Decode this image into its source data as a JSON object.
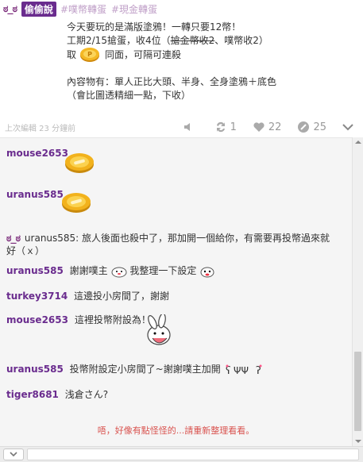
{
  "post": {
    "author_face": "ಠ_ಠ",
    "badge": "偷偷說",
    "tags": [
      "#噗幣轉蛋",
      "#現金轉蛋"
    ],
    "lines": {
      "l1": "今天要玩的是滿版塗鴉！一轉只要12幣！",
      "l2_a": "工期2/15搶蛋，收4位（",
      "l2_strike": "搶金幣收2",
      "l2_b": "、噗幣收2）",
      "l3_a": "取",
      "l3_b": "同面，可隔可連殺",
      "l5": "內容物有：單人正比大頭、半身、全身塗鴉＋底色",
      "l6": "（會比圖透精細一點，下收）"
    },
    "edited": "上次編輯 23 分鐘前",
    "actions": {
      "mute_icon": "mute-icon",
      "replurk_count": "1",
      "like_count": "22",
      "response_count": "25"
    }
  },
  "comments": [
    {
      "user": "mouse2653",
      "text": "",
      "sticker": "coin"
    },
    {
      "user": "uranus585",
      "text": "",
      "sticker": "coin"
    },
    {
      "user_face": "ಠ_ಠ",
      "text_a": "uranus585: 旅人後面也殺中了，那加開一個給你，有需要再投幣過來就",
      "text_b": "好（ｘ）"
    },
    {
      "user": "uranus585",
      "text_a": "謝謝噗主",
      "text_b": "我整理一下設定"
    },
    {
      "user": "turkey3714",
      "text": "這邊投小房間了，謝謝"
    },
    {
      "user": "mouse2653",
      "text": "這裡投幣附設為！"
    },
    {
      "user": "uranus585",
      "text": "投幣附設定小房間了~謝謝噗主加開"
    },
    {
      "user": "tiger8681",
      "text": "浅倉さん?"
    }
  ],
  "hint": "唔，好像有點怪怪的...請重新整理看看。",
  "colors": {
    "brand": "#6a2c8e",
    "hint": "#d9534f",
    "coin": "#f2b21c"
  }
}
